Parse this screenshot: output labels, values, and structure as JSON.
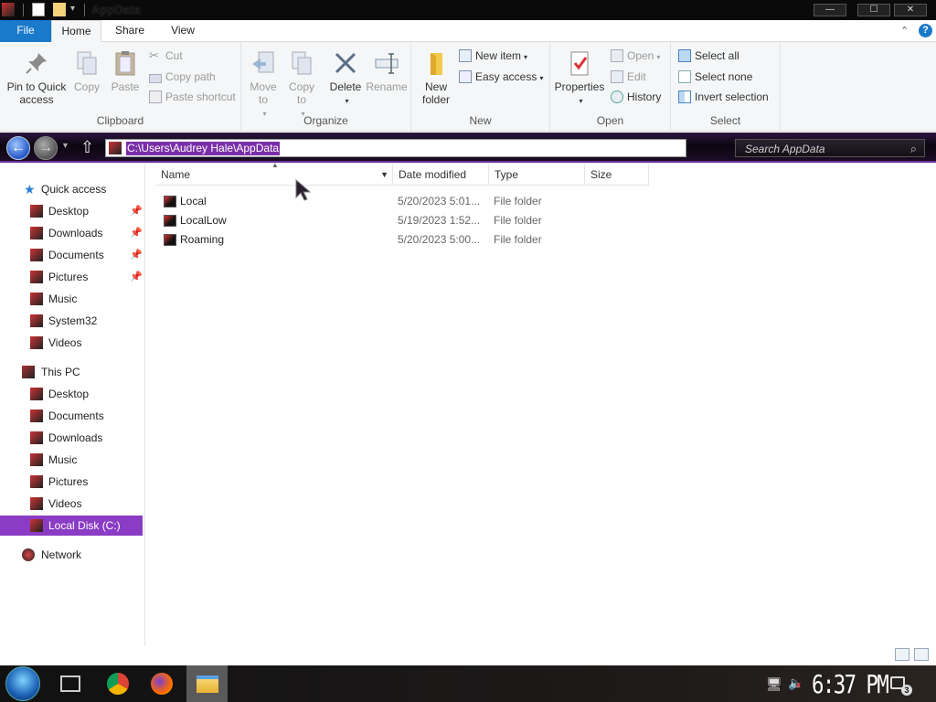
{
  "window": {
    "title": "AppData",
    "buttons": {
      "minimize": "—",
      "maximize": "☐",
      "close": "✕"
    }
  },
  "tabs": {
    "file": "File",
    "home": "Home",
    "share": "Share",
    "view": "View"
  },
  "ribbon": {
    "clipboard": {
      "label": "Clipboard",
      "pin": "Pin to Quick access",
      "copy": "Copy",
      "paste": "Paste",
      "cut": "Cut",
      "copy_path": "Copy path",
      "paste_shortcut": "Paste shortcut"
    },
    "organize": {
      "label": "Organize",
      "move_to": "Move to",
      "copy_to": "Copy to",
      "delete": "Delete",
      "rename": "Rename"
    },
    "new": {
      "label": "New",
      "new_folder": "New folder",
      "new_item": "New item",
      "easy_access": "Easy access"
    },
    "open": {
      "label": "Open",
      "properties": "Properties",
      "open": "Open",
      "edit": "Edit",
      "history": "History"
    },
    "select": {
      "label": "Select",
      "select_all": "Select all",
      "select_none": "Select none",
      "invert_selection": "Invert selection"
    }
  },
  "address": {
    "path": "C:\\Users\\Audrey Hale\\AppData",
    "search_placeholder": "Search AppData"
  },
  "nav": {
    "quick_access": "Quick access",
    "quick_items": [
      {
        "label": "Desktop",
        "pinned": true
      },
      {
        "label": "Downloads",
        "pinned": true
      },
      {
        "label": "Documents",
        "pinned": true
      },
      {
        "label": "Pictures",
        "pinned": true
      },
      {
        "label": "Music",
        "pinned": false
      },
      {
        "label": "System32",
        "pinned": false
      },
      {
        "label": "Videos",
        "pinned": false
      }
    ],
    "this_pc": "This PC",
    "pc_items": [
      "Desktop",
      "Documents",
      "Downloads",
      "Music",
      "Pictures",
      "Videos",
      "Local Disk (C:)"
    ],
    "network": "Network"
  },
  "columns": {
    "name": "Name",
    "date": "Date modified",
    "type": "Type",
    "size": "Size"
  },
  "files": [
    {
      "name": "Local",
      "date": "5/20/2023 5:01...",
      "type": "File folder"
    },
    {
      "name": "LocalLow",
      "date": "5/19/2023 1:52...",
      "type": "File folder"
    },
    {
      "name": "Roaming",
      "date": "5/20/2023 5:00...",
      "type": "File folder"
    }
  ],
  "taskbar": {
    "clock": "6:37 PM",
    "notifications": "3"
  },
  "colors": {
    "accent": "#1979ca",
    "selection": "#8a3cc4",
    "address_highlight": "#7a2fa8"
  }
}
